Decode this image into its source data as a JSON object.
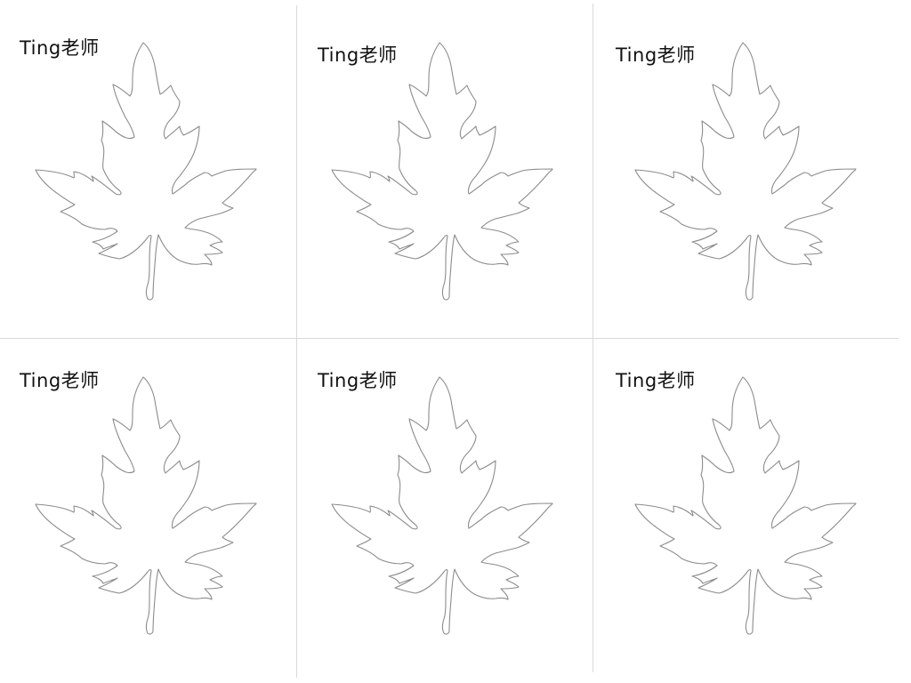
{
  "cards": [
    {
      "label": "Ting老师"
    },
    {
      "label": "Ting老师"
    },
    {
      "label": "Ting老师"
    },
    {
      "label": "Ting老师"
    },
    {
      "label": "Ting老师"
    },
    {
      "label": "Ting老师"
    }
  ],
  "colors": {
    "outline": "#8c8c8c",
    "divider": "#d9d9d9",
    "text": "#111111",
    "background": "#ffffff"
  },
  "icons": {
    "leaf": "maple-leaf-outline-icon"
  }
}
